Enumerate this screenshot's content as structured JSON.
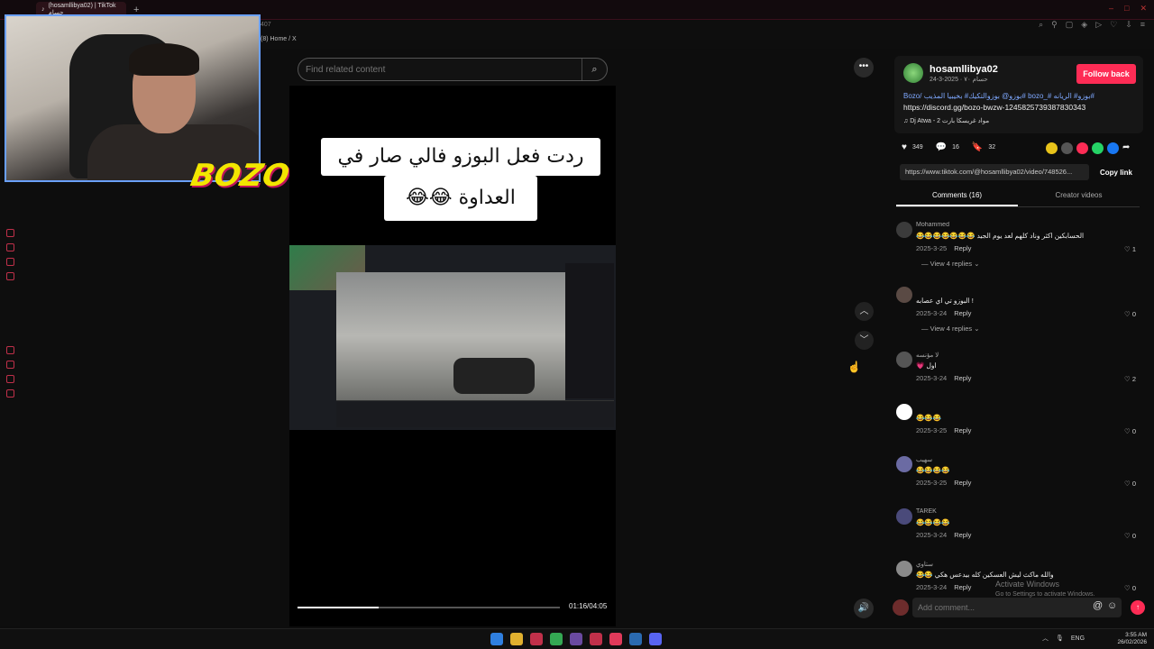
{
  "browser": {
    "tab_title": "(hosamllibya02) | TikTok حسام",
    "tab_plus": "+",
    "tab_count": "407",
    "breadcrumb": "(8) Home / X",
    "window_controls": [
      "–",
      "□",
      "✕"
    ]
  },
  "search": {
    "placeholder": "Find related content",
    "icon": "search-icon"
  },
  "video": {
    "caption_line1": "ردت فعل البوزو فالي صار في",
    "caption_line2": "العداوة 😂😂",
    "time": "01:16/04:05",
    "progress": 0.31
  },
  "controls": {
    "more": "•••",
    "up": "︿",
    "down": "﹀",
    "volume": "🔊"
  },
  "author": {
    "name": "hosamllibya02",
    "subtitle": "حسام ٧٠ · 2025-3-24",
    "follow_label": "Follow back",
    "hashtags": "Bozo/ بوزو@ بوزوالتكيك# بخيبيا المذيب# bozo_# بوزو# الريانه#",
    "discord_link": "https://discord.gg/bozo-bwzw-1245825739387830343",
    "music": "Dj Atwa - مواد غريسكا بارت 2"
  },
  "stats": {
    "likes": "349",
    "comments": "16",
    "saves": "32"
  },
  "share": {
    "url": "https://www.tiktok.com/@hosamllibya02/video/748526...",
    "copy_label": "Copy link",
    "colors": [
      "#e8c31a",
      "#555555",
      "#fe2c55",
      "#25d366",
      "#1877f2"
    ]
  },
  "tabs": {
    "comments": "Comments (16)",
    "creator": "Creator videos"
  },
  "comments": [
    {
      "name": "Mohammed",
      "text": "😂😂😂😂😂😂😂 الحسابكين اكثر وناد كلهم لعد يوم الجيد",
      "date": "2025-3-25",
      "reply": "Reply",
      "likes": "1",
      "view_replies": "View 4 replies",
      "avatar_color": "#3b3b3b"
    },
    {
      "name": "",
      "text": "البوزو تي اي عصابه !",
      "date": "2025-3-24",
      "reply": "Reply",
      "likes": "0",
      "view_replies": "View 4 replies",
      "avatar_color": "#5a4a44"
    },
    {
      "name": "لا مؤنسه",
      "text": "💗 اول",
      "date": "2025-3-24",
      "reply": "Reply",
      "likes": "2",
      "view_replies": "",
      "avatar_color": "#555555"
    },
    {
      "name": "",
      "text": "😂😂😂",
      "date": "2025-3-25",
      "reply": "Reply",
      "likes": "0",
      "view_replies": "",
      "avatar_color": "#ffffff"
    },
    {
      "name": "سهيب",
      "text": "😂😂😂😂",
      "date": "2025-3-25",
      "reply": "Reply",
      "likes": "0",
      "view_replies": "",
      "avatar_color": "#6b6ba3"
    },
    {
      "name": "TAREK",
      "text": "😂😂😂😂",
      "date": "2025-3-24",
      "reply": "Reply",
      "likes": "0",
      "view_replies": "",
      "avatar_color": "#4a4a7a"
    },
    {
      "name": "ستاوي",
      "text": "😂😂 والله ماكث ليش العسكين كله بيدعس هكي",
      "date": "2025-3-24",
      "reply": "Reply",
      "likes": "0",
      "view_replies": "",
      "avatar_color": "#8a8a8a"
    }
  ],
  "watermark": {
    "line1": "Activate Windows",
    "line2": "Go to Settings to activate Windows."
  },
  "add_comment": {
    "placeholder": "Add comment...",
    "at": "@",
    "emoji": "☺",
    "send": "↑"
  },
  "taskbar": {
    "apps": [
      "#2f7fe0",
      "#e0b02f",
      "#c0304a",
      "#34a853",
      "#6a4aa0",
      "#c0304a",
      "#e03a5a",
      "#2a6ab0",
      "#5865f2"
    ],
    "lang": "ENG",
    "time": "3:55 AM",
    "date": "26/02/2026"
  }
}
